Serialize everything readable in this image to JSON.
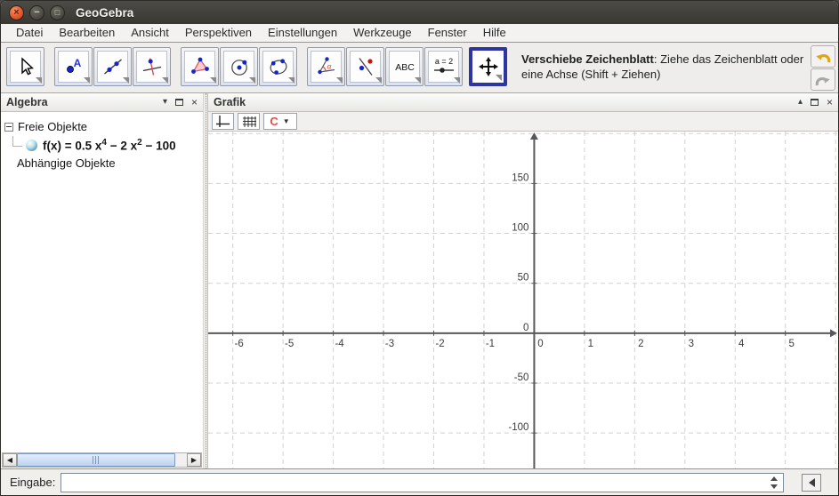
{
  "window": {
    "title": "GeoGebra"
  },
  "menu": {
    "items": [
      "Datei",
      "Bearbeiten",
      "Ansicht",
      "Perspektiven",
      "Einstellungen",
      "Werkzeuge",
      "Fenster",
      "Hilfe"
    ]
  },
  "toolbar": {
    "tools": [
      "move",
      "point",
      "line",
      "perpendicular-line",
      "polygon",
      "circle",
      "ellipse",
      "angle",
      "mirror",
      "text",
      "slider",
      "move-graphics-view"
    ],
    "selected_tool": "move-graphics-view",
    "text_tool_label": "ABC",
    "slider_tool_label": "a = 2",
    "help_bold": "Verschiebe Zeichenblatt",
    "help_rest": ": Ziehe das Zeichenblatt oder eine Achse (Shift + Ziehen)"
  },
  "algebra": {
    "title": "Algebra",
    "free_objects_label": "Freie Objekte",
    "dependent_objects_label": "Abhängige Objekte",
    "formula": {
      "name": "f(x)",
      "equals": " = ",
      "term1": "0.5 x",
      "exp1": "4",
      "term2": " − 2 x",
      "exp2": "2",
      "term3": " − 100"
    }
  },
  "grafik": {
    "title": "Grafik"
  },
  "inputbar": {
    "label": "Eingabe:",
    "value": ""
  },
  "chart_data": {
    "type": "line",
    "title": "",
    "function_label": "f(x) = 0.5 x^4 − 2 x^2 − 100",
    "coefficients": {
      "x4": 0.5,
      "x2": -2,
      "constant": -100
    },
    "x_range": [
      -6.49,
      6.05
    ],
    "y_range": [
      -135.5,
      202
    ],
    "x_ticks": [
      -6,
      -5,
      -4,
      -3,
      -2,
      -1,
      0,
      1,
      2,
      3,
      4,
      5
    ],
    "y_ticks": [
      -100,
      -50,
      0,
      50,
      100,
      150
    ],
    "x_grid_step": 1,
    "y_grid_step": 50,
    "grid": true,
    "legend": false,
    "colors": {
      "curve": "#1a1a1a",
      "axis": "#58585a",
      "grid": "#d2d2d2",
      "tick_label": "#3c3c3c"
    }
  }
}
